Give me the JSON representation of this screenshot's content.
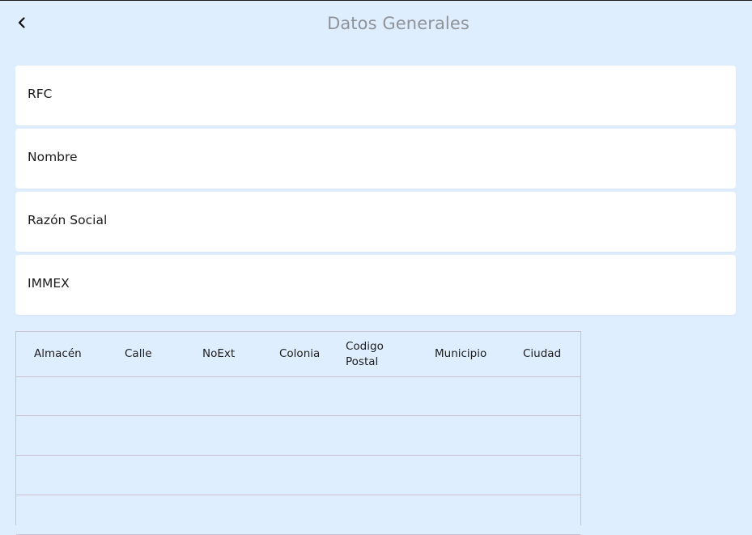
{
  "header": {
    "title": "Datos Generales",
    "back_icon": "chevron-left-icon"
  },
  "form": {
    "fields": [
      {
        "label": "RFC"
      },
      {
        "label": "Nombre"
      },
      {
        "label": "Razón Social"
      },
      {
        "label": "IMMEX"
      }
    ]
  },
  "table": {
    "columns": [
      "Almacén",
      "Calle",
      "NoExt",
      "Colonia",
      "Codigo Postal",
      "Municipio",
      "Ciudad"
    ],
    "rows": [
      [],
      [],
      [],
      []
    ]
  }
}
